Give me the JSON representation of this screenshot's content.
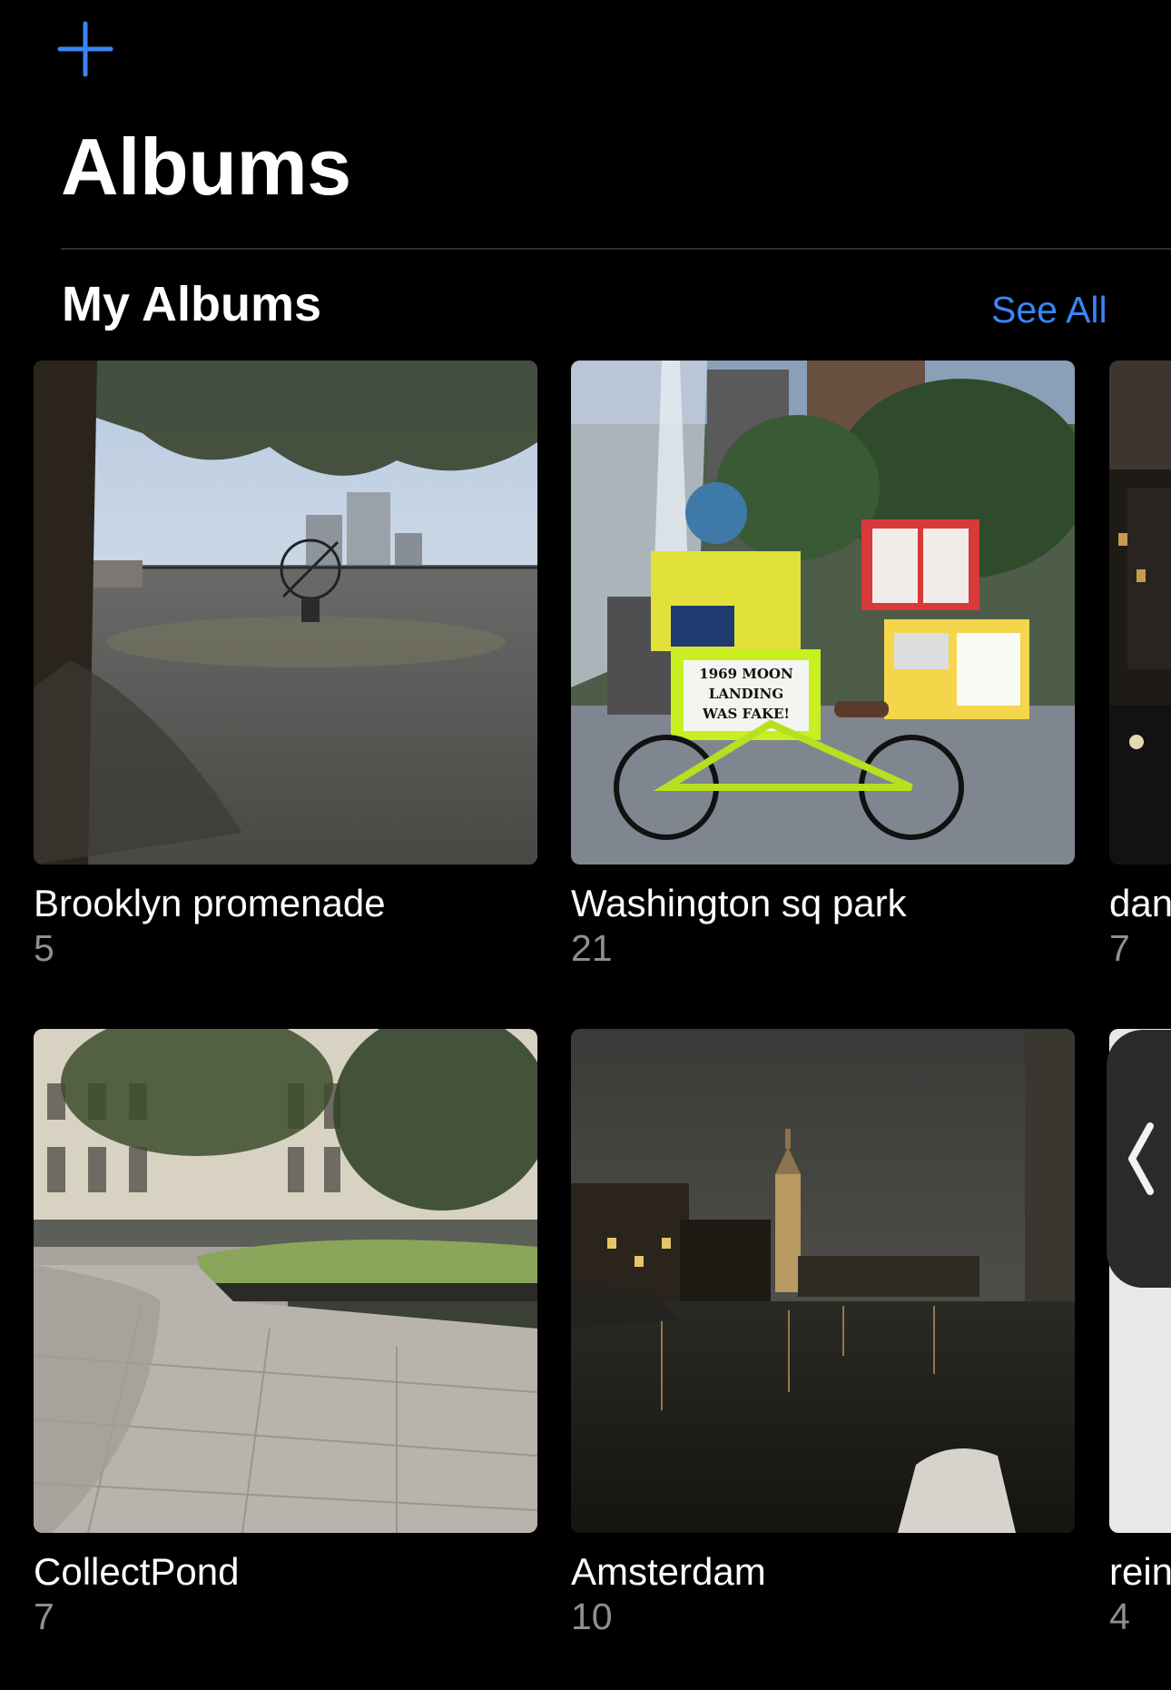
{
  "header": {
    "add_icon": "plus-icon",
    "title": "Albums"
  },
  "my_albums": {
    "section_title": "My Albums",
    "see_all_label": "See All",
    "albums": [
      {
        "name": "Brooklyn promenade",
        "count": "5"
      },
      {
        "name": "Washington sq park",
        "count": "21"
      },
      {
        "name": "dan",
        "count": "7"
      },
      {
        "name": "CollectPond",
        "count": "7"
      },
      {
        "name": "Amsterdam",
        "count": "10"
      },
      {
        "name": "rein",
        "count": "4"
      }
    ]
  },
  "sign_texts": {
    "moon_sign": [
      "1969 MOON",
      "LANDING",
      "WAS FAKE!"
    ]
  },
  "colors": {
    "accent": "#3a85f5",
    "background": "#000000",
    "secondary_text": "#8e8e93"
  },
  "side_handle_icon": "chevron-left-icon"
}
